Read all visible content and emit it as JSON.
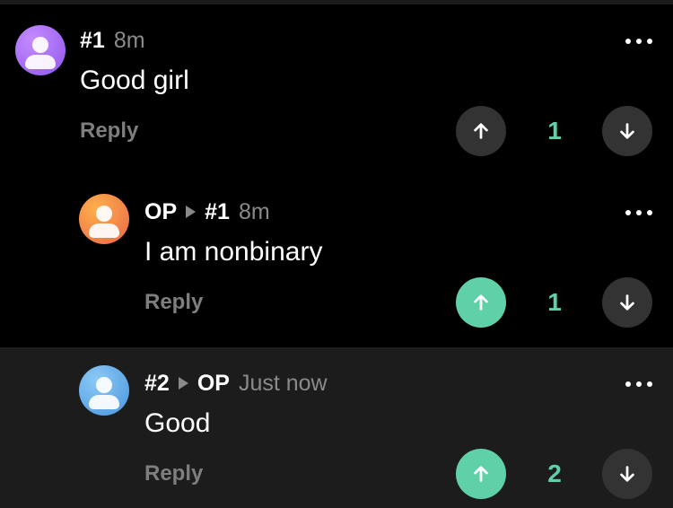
{
  "comments": [
    {
      "author": "#1",
      "reply_to": "",
      "time": "8m",
      "text": "Good girl",
      "reply_label": "Reply",
      "score": "1",
      "avatar_color": "#a06ef5",
      "upvoted": false,
      "more_icon": "more-horizontal-icon"
    },
    {
      "author": "OP",
      "reply_to": "#1",
      "time": "8m",
      "text": "I am nonbinary",
      "reply_label": "Reply",
      "score": "1",
      "avatar_color": "#f08a3a",
      "upvoted": true,
      "more_icon": "more-horizontal-icon"
    },
    {
      "author": "#2",
      "reply_to": "OP",
      "time": "Just now",
      "text": "Good",
      "reply_label": "Reply",
      "score": "2",
      "avatar_color": "#5aa8e8",
      "upvoted": true,
      "more_icon": "more-horizontal-icon"
    }
  ],
  "colors": {
    "accent": "#5fd0a8",
    "background": "#000000",
    "highlight_background": "#1c1c1c",
    "muted_text": "#8a8a8a"
  }
}
